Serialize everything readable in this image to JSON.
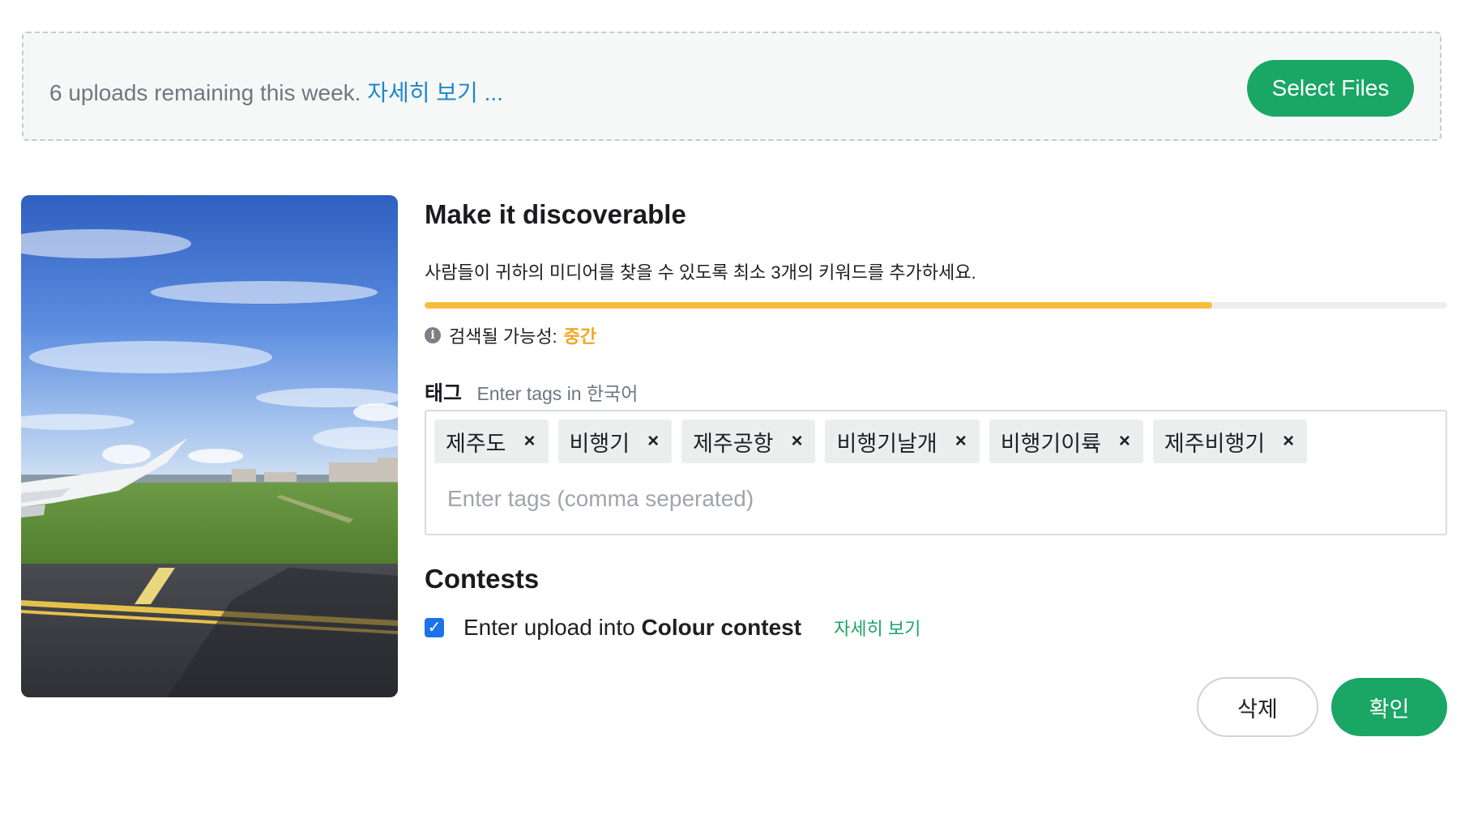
{
  "banner": {
    "remaining_text": "6 uploads remaining this week.",
    "details_link": "자세히 보기 ...",
    "select_files_label": "Select Files"
  },
  "discover": {
    "heading": "Make it discoverable",
    "description": "사람들이 귀하의 미디어를 찾을 수 있도록 최소 3개의 키워드를 추가하세요.",
    "progress_fraction": 0.77,
    "progress_color": "#f9bd3c",
    "discoverability_label": "검색될 가능성:",
    "discoverability_value": "중간"
  },
  "tags": {
    "label": "태그",
    "hint": "Enter tags in 한국어",
    "items": [
      "제주도",
      "비행기",
      "제주공항",
      "비행기날개",
      "비행기이륙",
      "제주비행기"
    ],
    "remove_symbol": "×",
    "input_value": "",
    "input_placeholder": "Enter tags (comma seperated)"
  },
  "contests": {
    "heading": "Contests",
    "checked": true,
    "entry_prefix": "Enter upload into",
    "contest_name": "Colour contest",
    "details_link": "자세히 보기"
  },
  "actions": {
    "delete_label": "삭제",
    "confirm_label": "확인"
  },
  "colors": {
    "accent_green": "#1aa665",
    "link_blue": "#1e88c9",
    "warning_orange": "#f5a623",
    "checkbox_blue": "#1a73e8"
  }
}
